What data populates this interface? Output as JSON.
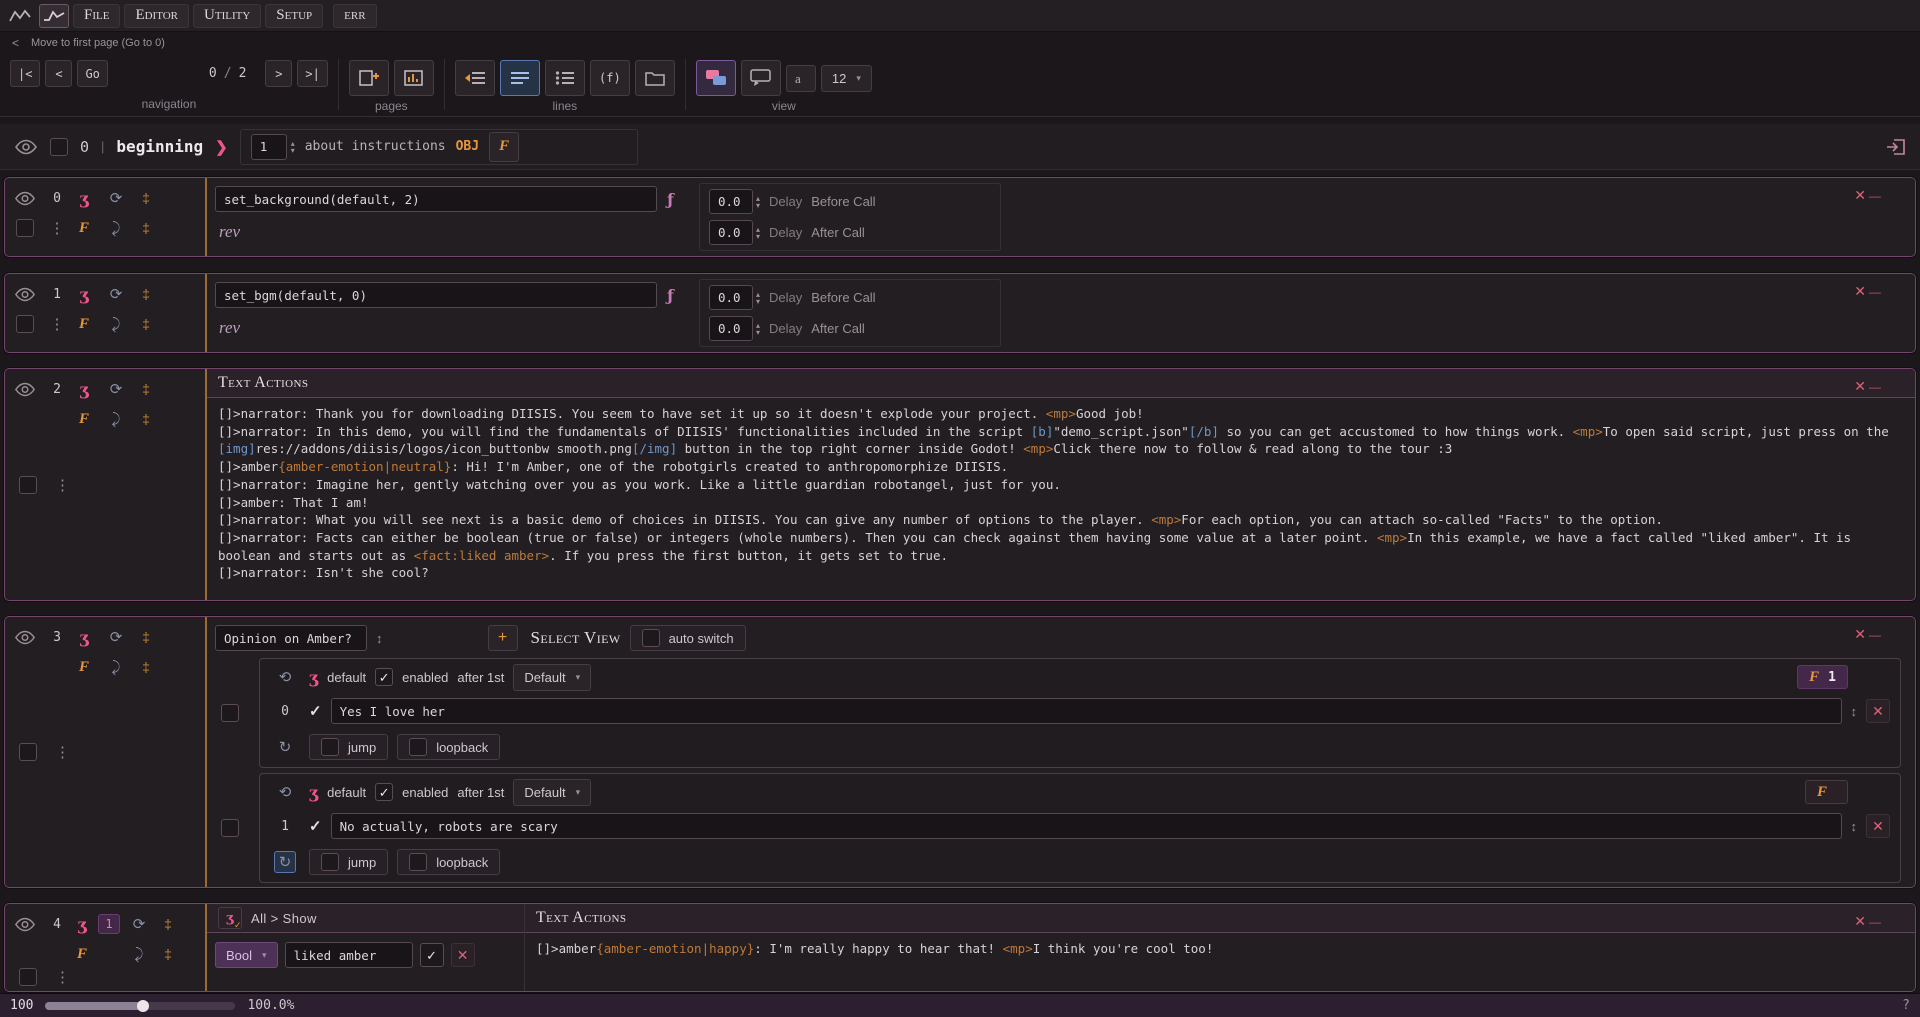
{
  "menubar": {
    "items": [
      "File",
      "Editor",
      "Utility",
      "Setup"
    ],
    "err": "err"
  },
  "nav_hint": {
    "back": "<",
    "label": "Move to first page (Go to 0)"
  },
  "toolbar": {
    "navigation": {
      "label": "navigation",
      "first": "|<",
      "prev": "<",
      "go": "Go",
      "current": "0",
      "sep": "/",
      "total": "2",
      "next": ">",
      "last": ">|"
    },
    "pages": {
      "label": "pages"
    },
    "lines": {
      "label": "lines",
      "fn": "(f)"
    },
    "view": {
      "label": "view",
      "font_size": "12"
    }
  },
  "page_header": {
    "page": "0",
    "sep": "|",
    "title": "beginning",
    "line": "1",
    "desc": "about instructions",
    "obj": "OBJ"
  },
  "labels": {
    "delay": "Delay",
    "before_call": "Before Call",
    "after_call": "After Call",
    "rev": "rev",
    "text_actions": "Text Actions",
    "default_opt": "default",
    "enabled": "enabled",
    "after_first": "after 1st",
    "behavior": "Default",
    "jump": "jump",
    "loopback": "loopback",
    "select_view": "Select View",
    "auto_switch": "auto switch"
  },
  "blocks": {
    "b0": {
      "index": "0",
      "code": "set_background(default, 2)",
      "delay_before": "0.0",
      "delay_after": "0.0"
    },
    "b1": {
      "index": "1",
      "code": "set_bgm(default, 0)",
      "delay_before": "0.0",
      "delay_after": "0.0"
    },
    "b2": {
      "index": "2",
      "dialogue": [
        [
          {
            "t": "[]>narrator: Thank you for downloading DIISIS. You seem to have set it up so it doesn't explode your project. ",
            "c": "p"
          },
          {
            "t": "<mp>",
            "c": "t"
          },
          {
            "t": "Good job!",
            "c": "p"
          }
        ],
        [
          {
            "t": "[]>narrator: In this demo, you will find the fundamentals of DIISIS' functionalities included in the script ",
            "c": "p"
          },
          {
            "t": "[b]",
            "c": "b"
          },
          {
            "t": "\"demo_script.json\"",
            "c": "p"
          },
          {
            "t": "[/b]",
            "c": "b"
          },
          {
            "t": " so you can get accustomed to how things work. ",
            "c": "p"
          },
          {
            "t": "<mp>",
            "c": "t"
          },
          {
            "t": "To open said script, just press on the ",
            "c": "p"
          },
          {
            "t": "[img]",
            "c": "b"
          },
          {
            "t": "res://addons/diisis/logos/icon_buttonbw smooth.png",
            "c": "p"
          },
          {
            "t": "[/img]",
            "c": "b"
          },
          {
            "t": " button in the top right corner inside Godot! ",
            "c": "p"
          },
          {
            "t": "<mp>",
            "c": "t"
          },
          {
            "t": "Click there now to follow & read along to the tour :3",
            "c": "p"
          }
        ],
        [
          {
            "t": "[]>amber",
            "c": "p"
          },
          {
            "t": "{amber-emotion|neutral}",
            "c": "t"
          },
          {
            "t": ": Hi! I'm Amber, one of the robotgirls created to anthropomorphize DIISIS.",
            "c": "p"
          }
        ],
        [
          {
            "t": "[]>narrator: Imagine her, gently watching over you as you work. Like a little guardian robotangel, just for you.",
            "c": "p"
          }
        ],
        [
          {
            "t": "[]>amber: That I am!",
            "c": "p"
          }
        ],
        [
          {
            "t": "[]>narrator: What you will see next is a basic demo of choices in DIISIS. You can give any number of options to the player. ",
            "c": "p"
          },
          {
            "t": "<mp>",
            "c": "t"
          },
          {
            "t": "For each option, you can attach so-called \"Facts\" to the option.",
            "c": "p"
          }
        ],
        [
          {
            "t": "[]>narrator: Facts can either be boolean (true or false) or integers (whole numbers). Then you can check against them having some value at a later point. ",
            "c": "p"
          },
          {
            "t": "<mp>",
            "c": "t"
          },
          {
            "t": "In this example, we have a fact called \"liked amber\". It is boolean and starts out as ",
            "c": "p"
          },
          {
            "t": "<fact:liked amber>",
            "c": "t"
          },
          {
            "t": ". If you press the first button, it gets set to true.",
            "c": "p"
          }
        ],
        [
          {
            "t": "[]>narrator: Isn't she cool?",
            "c": "p"
          }
        ]
      ]
    },
    "b3": {
      "index": "3",
      "title": "Opinion on Amber?",
      "add": "+",
      "choices": [
        {
          "index": "0",
          "text": "Yes I love her",
          "facts_count": "1"
        },
        {
          "index": "1",
          "text": "No actually, robots are scary",
          "facts_count": ""
        }
      ]
    },
    "b4": {
      "index": "4",
      "badge": "1",
      "condition": "All > Show",
      "type": "Bool",
      "fact": "liked amber",
      "dialogue": [
        [
          {
            "t": "[]>amber",
            "c": "p"
          },
          {
            "t": "{amber-emotion|happy}",
            "c": "t"
          },
          {
            "t": ": I'm really happy to hear that! ",
            "c": "p"
          },
          {
            "t": "<mp>",
            "c": "t"
          },
          {
            "t": "I think you're cool too!",
            "c": "p"
          }
        ]
      ]
    }
  },
  "statusbar": {
    "value": "100",
    "zoom": "100.0%",
    "help": "?"
  },
  "icons": {
    "line_type": "ʒ",
    "facts": "F",
    "loop": "⟳",
    "loop_start": "⟲",
    "loop_end": "↻",
    "jump_icon": "⤸",
    "insert": "‡",
    "dots": "⋮",
    "check": "✓",
    "close": "✕",
    "dash": "—",
    "caret": "▾",
    "updown": "↕",
    "func": "ƒ",
    "arrow": "❯",
    "spin_up": "▴",
    "spin_down": "▾",
    "plus": "+"
  },
  "colors": {
    "accent_pink": "#f0558a",
    "accent_orange": "#e8963c",
    "tag_orange": "#bd7a3a",
    "tag_blue": "#6f96c8"
  }
}
